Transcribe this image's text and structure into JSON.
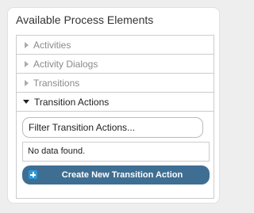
{
  "panel": {
    "title": "Available Process Elements"
  },
  "sections": [
    {
      "label": "Activities",
      "expanded": false
    },
    {
      "label": "Activity Dialogs",
      "expanded": false
    },
    {
      "label": "Transitions",
      "expanded": false
    },
    {
      "label": "Transition Actions",
      "expanded": true
    }
  ],
  "transition_actions": {
    "filter_placeholder": "Filter Transition Actions...",
    "empty_text": "No data found.",
    "create_button_label": "Create New Transition Action",
    "create_icon": "plus-icon"
  },
  "colors": {
    "button_bg": "#3f6e93",
    "icon_bg": "#2a9ad8"
  }
}
